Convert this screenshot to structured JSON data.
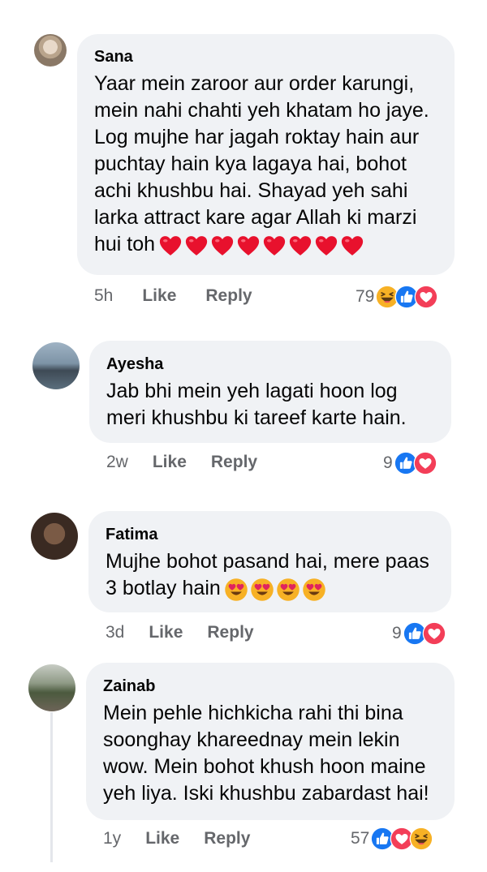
{
  "comments": [
    {
      "author": "Sana",
      "lines": [
        "Yaar mein zaroor aur order karungi,",
        "mein nahi chahti yeh khatam ho jaye.",
        "Log mujhe har jagah roktay hain aur",
        "puchtay hain kya lagaya hai, bohot",
        "achi khushbu hai. Shayad yeh sahi",
        "larka attract kare agar Allah ki marzi",
        "hui toh"
      ],
      "trailing_emoji": "red-heart-emoji",
      "trailing_emoji_count": 8,
      "time": "5h",
      "like_label": "Like",
      "reply_label": "Reply",
      "reaction_count": "79",
      "reaction_icons": [
        "haha-icon",
        "like-icon",
        "love-icon"
      ]
    },
    {
      "author": "Ayesha",
      "lines": [
        "Jab bhi mein yeh lagati hoon log",
        "meri khushbu ki tareef karte hain."
      ],
      "time": "2w",
      "like_label": "Like",
      "reply_label": "Reply",
      "reaction_count": "9",
      "reaction_icons": [
        "like-icon",
        "love-icon"
      ]
    },
    {
      "author": "Fatima",
      "lines": [
        "Mujhe bohot pasand hai, mere paas",
        "3 botlay hain"
      ],
      "trailing_emoji": "heart-eyes-emoji",
      "trailing_emoji_count": 4,
      "time": "3d",
      "like_label": "Like",
      "reply_label": "Reply",
      "reaction_count": "9",
      "reaction_icons": [
        "like-icon",
        "love-icon"
      ]
    },
    {
      "author": "Zainab",
      "lines": [
        "Mein pehle hichkicha rahi thi bina",
        "soonghay khareednay mein lekin",
        "wow. Mein bohot khush hoon maine",
        "yeh liya. Iski khushbu zabardast hai!"
      ],
      "time": "1y",
      "like_label": "Like",
      "reply_label": "Reply",
      "reaction_count": "57",
      "reaction_icons": [
        "like-icon",
        "love-icon",
        "haha-icon"
      ]
    }
  ],
  "colors": {
    "bubble": "#f0f2f5",
    "meta_text": "#65676b",
    "like_blue": "#1877f2",
    "love_red": "#f33e58",
    "haha_yellow": "#f7b125",
    "heart_red": "#e8112d"
  }
}
